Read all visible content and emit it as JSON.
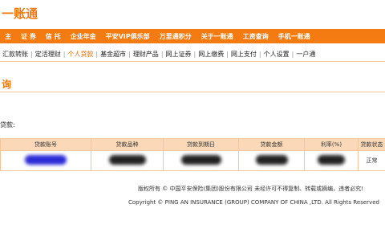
{
  "logo_text": "一账通",
  "topnav": [
    "主",
    "证 券",
    "信 托",
    "企业年金",
    "平安VIP俱乐部",
    "万里通积分",
    "关于一账通",
    "工资查询",
    "手机一账通"
  ],
  "subnav": [
    "汇款转账",
    "定活理财",
    "个人贷款",
    "基金超市",
    "理财产品",
    "网上证券",
    "网上缴费",
    "网上支付",
    "个人设置",
    "一户通"
  ],
  "subnav_active": "个人贷款",
  "section_title": "询",
  "list_label": "贷款:",
  "table": {
    "headers": [
      "贷款账号",
      "贷款品种",
      "贷款到期日",
      "贷款金额",
      "利率(%)",
      "贷款状态"
    ],
    "rows": [
      {
        "status": "正常"
      }
    ]
  },
  "footer": {
    "line1": "版权所有 © 中国平安保险(集团)股份有限公司 未经许可不得复制、转载或摘编，违者必究!",
    "line2": "Copyright © PING AN INSURANCE (GROUP) COMPANY OF CHINA ,LTD. All Rights Reserved"
  },
  "colors": {
    "brand_orange": "#f47a12",
    "header_bg": "#fbd9b8",
    "border": "#f2c59a"
  }
}
